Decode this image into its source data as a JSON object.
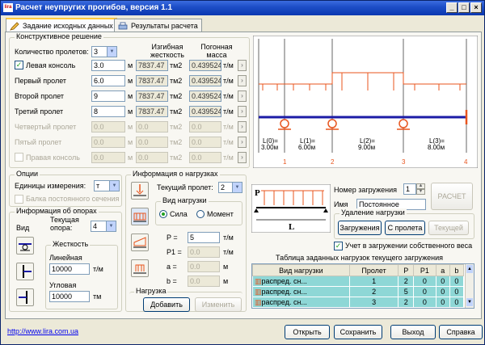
{
  "window": {
    "title": "Расчет неупругих прогибов, версия 1.1",
    "logo_text": "lira"
  },
  "tabs": [
    {
      "label": "Задание исходных данных",
      "icon": "pencil-icon"
    },
    {
      "label": "Результаты расчета",
      "icon": "printer-icon"
    }
  ],
  "structural": {
    "group_title": "Конструктивное решение",
    "spans_count_label": "Количество пролетов:",
    "spans_count_value": "3",
    "col_stiffness": "Изгибная жесткость",
    "col_mass": "Погонная масса",
    "rows": [
      {
        "label": "Левая консоль",
        "checkbox": true,
        "checked": true,
        "length": "3.0",
        "stiffness": "7837.47",
        "mass": "0.439524",
        "unit_len": "м",
        "unit_stiff": "тм2",
        "unit_mass": "т/м",
        "enabled": true
      },
      {
        "label": "Первый пролет",
        "checkbox": false,
        "length": "6.0",
        "stiffness": "7837.47",
        "mass": "0.439524",
        "unit_len": "м",
        "unit_stiff": "тм2",
        "unit_mass": "т/м",
        "enabled": true
      },
      {
        "label": "Второй пролет",
        "checkbox": false,
        "length": "9",
        "stiffness": "7837.47",
        "mass": "0.439524",
        "unit_len": "м",
        "unit_stiff": "тм2",
        "unit_mass": "т/м",
        "enabled": true
      },
      {
        "label": "Третий пролет",
        "checkbox": false,
        "length": "8",
        "stiffness": "7837.47",
        "mass": "0.439524",
        "unit_len": "м",
        "unit_stiff": "тм2",
        "unit_mass": "т/м",
        "enabled": true
      },
      {
        "label": "Четвертый пролет",
        "checkbox": false,
        "length": "0.0",
        "stiffness": "0.0",
        "mass": "0.0",
        "unit_len": "м",
        "unit_stiff": "тм2",
        "unit_mass": "т/м",
        "enabled": false
      },
      {
        "label": "Пятый пролет",
        "checkbox": false,
        "length": "0.0",
        "stiffness": "0.0",
        "mass": "0.0",
        "unit_len": "м",
        "unit_stiff": "тм2",
        "unit_mass": "т/м",
        "enabled": false
      },
      {
        "label": "Правая консоль",
        "checkbox": true,
        "checked": false,
        "length": "0.0",
        "stiffness": "0.0",
        "mass": "0.0",
        "unit_len": "м",
        "unit_stiff": "тм2",
        "unit_mass": "т/м",
        "enabled": false
      }
    ],
    "arrow_button": "›"
  },
  "beam": {
    "span_labels": [
      "L(0)=\n3.00м",
      "L(1)=\n6.00м",
      "L(2)=\n9.00м",
      "L(3)=\n8.00м"
    ],
    "span_l": [
      "L(0)=",
      "L(1)=",
      "L(2)=",
      "L(3)="
    ],
    "span_v": [
      "3.00м",
      "6.00м",
      "9.00м",
      "8.00м"
    ],
    "node_numbers": [
      "1",
      "2",
      "3",
      "4"
    ]
  },
  "options": {
    "group_title": "Опции",
    "units_label": "Единицы измерения:",
    "units_value": "т",
    "beam_const_label": "Балка постоянного сечения"
  },
  "supports": {
    "group_title": "Информация об опорах",
    "view_label": "Вид",
    "current_label": "Текущая опора:",
    "current_value": "4",
    "stiffness_title": "Жесткость",
    "linear_label": "Линейная",
    "linear_value": "10000",
    "linear_unit": "т/м",
    "angular_label": "Угловая",
    "angular_value": "10000",
    "angular_unit": "тм"
  },
  "loads": {
    "group_title": "Информация о нагрузках",
    "current_span_label": "Текущий пролет:",
    "current_span_value": "2",
    "type_title": "Вид нагрузки",
    "force_label": "Сила",
    "moment_label": "Момент",
    "p_label": "P =",
    "p_value": "5",
    "p_unit": "т/м",
    "p1_label": "P1 =",
    "p1_value": "0.0",
    "p1_unit": "т/м",
    "a_label": "a =",
    "a_value": "0.0",
    "a_unit": "м",
    "b_label": "b =",
    "b_value": "0.0",
    "b_unit": "м",
    "load_group_title": "Нагрузка",
    "add_button": "Добавить",
    "edit_button": "Изменить"
  },
  "diagram": {
    "p": "P",
    "l": "L"
  },
  "loadcase": {
    "number_label": "Номер загружения",
    "number_value": "1",
    "name_label": "Имя",
    "name_value": "Постоянное",
    "calc_button": "РАСЧЕТ",
    "remove_title": "Удаление нагрузки",
    "btn_loadcase": "Загружения",
    "btn_span": "С пролета",
    "btn_current": "Текущей",
    "selfweight_label": "Учет в загружении собственного веса",
    "table_title": "Таблица заданных нагрузок текущего загружения",
    "columns": [
      "Вид нагрузки",
      "Пролет",
      "P",
      "P1",
      "a",
      "b"
    ],
    "rows": [
      [
        "распред. сн...",
        "1",
        "2",
        "0",
        "0",
        "0"
      ],
      [
        "распред. сн...",
        "2",
        "5",
        "0",
        "0",
        "0"
      ],
      [
        "распред. сн...",
        "3",
        "2",
        "0",
        "0",
        "0"
      ]
    ]
  },
  "footer": {
    "link": "http://www.lira.com.ua",
    "open": "Открыть",
    "save": "Сохранить",
    "exit": "Выход",
    "help": "Справка"
  }
}
